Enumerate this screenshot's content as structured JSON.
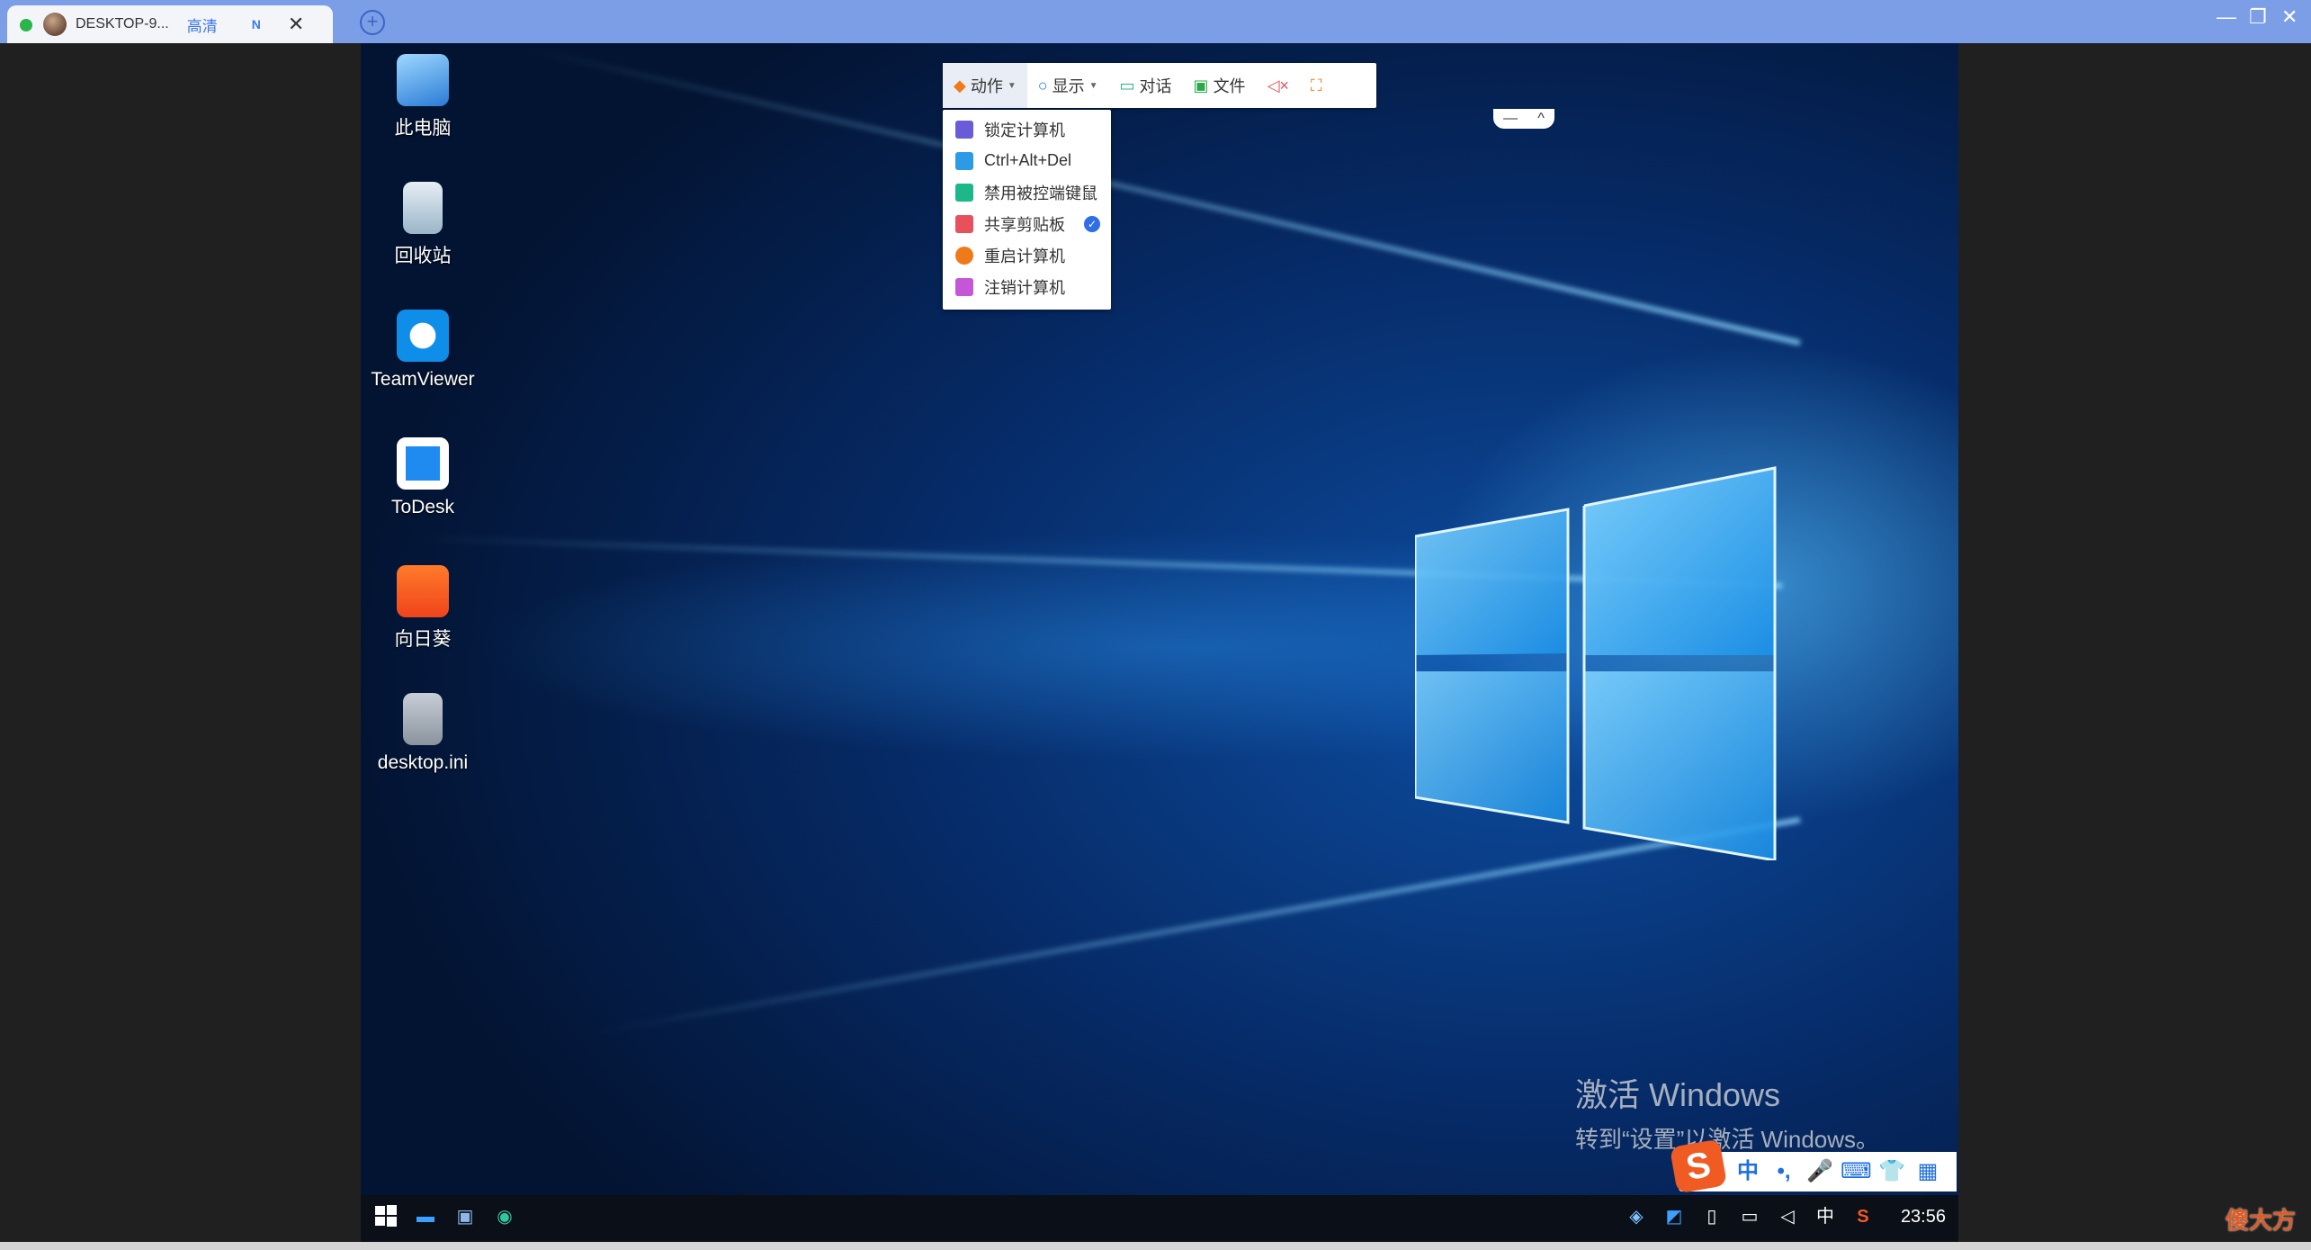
{
  "window": {
    "tab_title": "DESKTOP-9...",
    "tab_quality": "高清",
    "tab_badge": "N",
    "tab_close": "✕",
    "new_tab": "+",
    "minimize": "—",
    "restore": "❐",
    "close": "✕"
  },
  "desktop_icons": [
    {
      "label": "此电脑",
      "icon": "computer-icon"
    },
    {
      "label": "回收站",
      "icon": "recycle-bin-icon"
    },
    {
      "label": "TeamViewer",
      "icon": "teamviewer-icon"
    },
    {
      "label": "ToDesk",
      "icon": "todesk-icon"
    },
    {
      "label": "向日葵",
      "icon": "sunlogin-icon"
    },
    {
      "label": "desktop.ini",
      "icon": "settings-file-icon"
    }
  ],
  "toolbar": {
    "action": "动作",
    "display": "显示",
    "chat": "对话",
    "file": "文件",
    "handle_minus": "—",
    "handle_up": "^"
  },
  "action_menu": [
    {
      "label": "锁定计算机",
      "icon": "lock-icon",
      "color": "#6a5bd8"
    },
    {
      "label": "Ctrl+Alt+Del",
      "icon": "send-icon",
      "color": "#2b9be6"
    },
    {
      "label": "禁用被控端键鼠",
      "icon": "keyboard-mouse-icon",
      "color": "#1cb88a"
    },
    {
      "label": "共享剪贴板",
      "icon": "clipboard-icon",
      "color": "#e8505b",
      "checked": true
    },
    {
      "label": "重启计算机",
      "icon": "restart-icon",
      "color": "#f07a1a"
    },
    {
      "label": "注销计算机",
      "icon": "logout-icon",
      "color": "#c556d8"
    }
  ],
  "watermark": {
    "line1": "激活 Windows",
    "line2": "转到“设置”以激活 Windows。"
  },
  "ime": {
    "brand": "S",
    "lang": "中",
    "punct": "•,",
    "mic": "🎤",
    "keyboard": "⌨",
    "skin": "👕",
    "apps": "▦"
  },
  "taskbar": {
    "tray_lang": "中",
    "clock": "23:56"
  },
  "corner_logo": "傻大方"
}
